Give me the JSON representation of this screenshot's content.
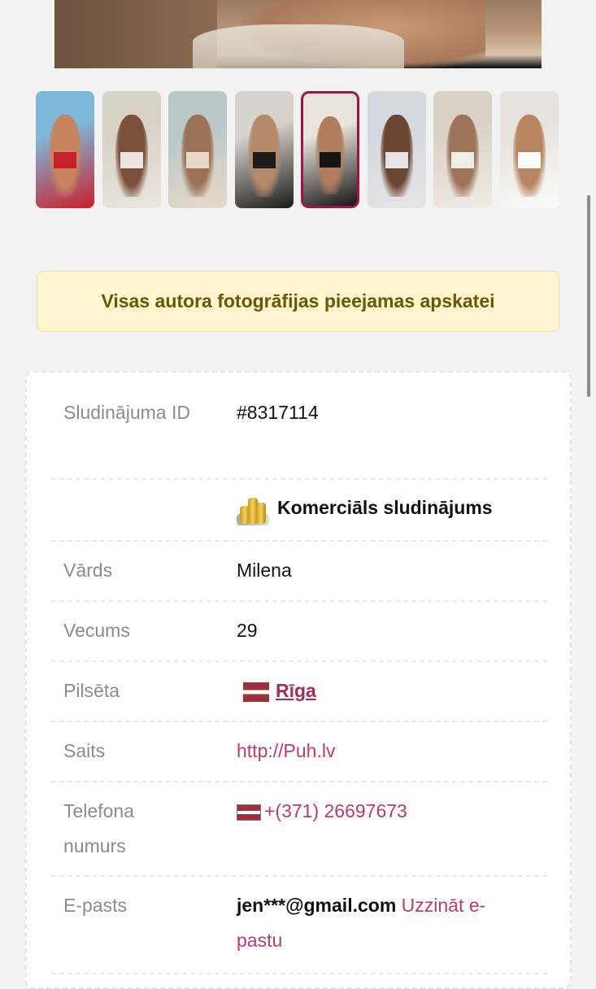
{
  "gallery": {
    "thumbnails": [
      {
        "colors": [
          "#7db8d9",
          "#c8845e",
          "#c8202c"
        ],
        "active": false
      },
      {
        "colors": [
          "#d8d1c6",
          "#7a5038",
          "#eae6df"
        ],
        "active": false
      },
      {
        "colors": [
          "#b9c7c9",
          "#9b7256",
          "#e8dac8"
        ],
        "active": false
      },
      {
        "colors": [
          "#d7d2cb",
          "#b58a6b",
          "#1b1b1b"
        ],
        "active": false
      },
      {
        "colors": [
          "#e9e4dc",
          "#b27d5f",
          "#151515"
        ],
        "active": true
      },
      {
        "colors": [
          "#d5d8de",
          "#6c4531",
          "#e5e5e5"
        ],
        "active": false
      },
      {
        "colors": [
          "#d9d1c6",
          "#9d7458",
          "#f0ece6"
        ],
        "active": false
      },
      {
        "colors": [
          "#e6e2dd",
          "#b88462",
          "#fbfbfb"
        ],
        "active": false
      }
    ],
    "active_border_color": "#a0144a"
  },
  "notice": {
    "text": "Visas autora fotogrāfijas pieejamas apskatei"
  },
  "details": {
    "ad_id_label": "Sludinājuma ID",
    "ad_id_value": "#8317114",
    "commercial_icon": "coins-icon",
    "commercial_text": "Komerciāls sludinājums",
    "name_label": "Vārds",
    "name_value": "Milena",
    "age_label": "Vecums",
    "age_value": "29",
    "city_label": "Pilsēta",
    "city_flag_icon": "latvia-flag-icon",
    "city_value": "Rīga",
    "site_label": "Saits",
    "site_value": "http://Puh.lv",
    "phone_label": "Telefona numurs",
    "phone_flag_icon": "latvia-flag-icon",
    "phone_value": "+(371) 26697673",
    "email_label": "E-pasts",
    "email_value": "jen***@gmail.com",
    "email_reveal": "Uzzināt e-pastu"
  },
  "colors": {
    "accent": "#bb3a6b",
    "notice_bg": "#fef4cd",
    "notice_text": "#6b5607"
  }
}
